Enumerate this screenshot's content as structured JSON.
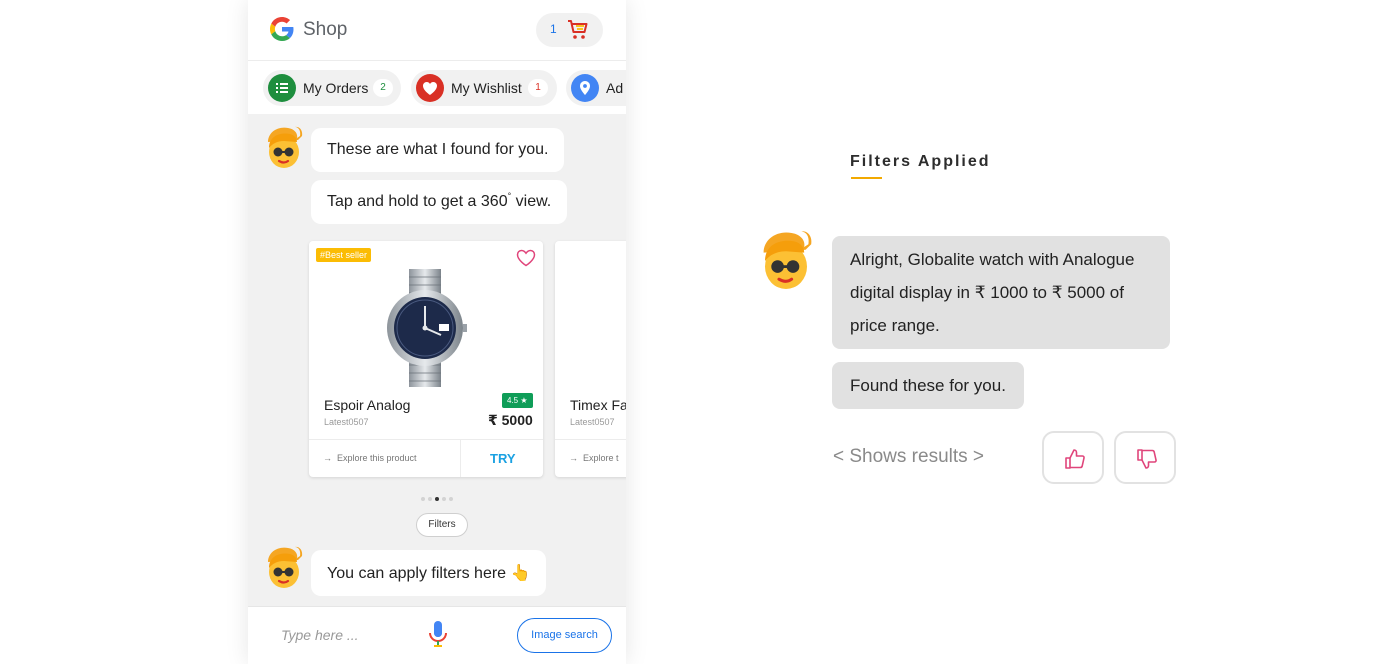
{
  "app": {
    "title": "Shop",
    "cart_count": "1"
  },
  "chips": [
    {
      "label": "My Orders",
      "count": "2",
      "icon": "list-icon",
      "color": "#1e8e3e",
      "badge_color": "#1e8e3e"
    },
    {
      "label": "My Wishlist",
      "count": "1",
      "icon": "heart-icon",
      "color": "#d93025",
      "badge_color": "#d93025"
    },
    {
      "label": "Ad",
      "icon": "location-pin-icon",
      "color": "#4285f4"
    }
  ],
  "chat": {
    "msg1": "These are what I found for you.",
    "msg2_before": "Tap and hold to get a 360",
    "msg2_sup": "°",
    "msg2_after": " view.",
    "filters_chip": "Filters",
    "msg3": "You can apply filters here 👆"
  },
  "products": [
    {
      "tag": "#Best seller",
      "name": "Espoir Analog",
      "sku": "Latest0507",
      "rating": "4.5 ★",
      "price": "₹ 5000",
      "explore": "Explore this product",
      "try": "TRY"
    },
    {
      "name": "Timex Fa",
      "sku": "Latest0507",
      "explore": "Explore t"
    }
  ],
  "carousel": {
    "count": 5,
    "active": 2
  },
  "input": {
    "placeholder": "Type here ...",
    "image_search": "Image search"
  },
  "panel": {
    "title": "Filters Applied",
    "reply1_line1": "Alright, Globalite watch with Analogue",
    "reply1_line2": "digital display in ₹ 1000 to ₹ 5000 of",
    "reply1_line3": "price range.",
    "reply2": "Found these for you.",
    "results_hint": "< Shows results >"
  },
  "colors": {
    "accent_blue": "#1a73e8",
    "try_blue": "#1ba1e2",
    "rating_green": "#0f9d58",
    "tag_yellow": "#fbbc04",
    "title_underline": "#f2a900",
    "feedback_pink": "#e0457b"
  }
}
